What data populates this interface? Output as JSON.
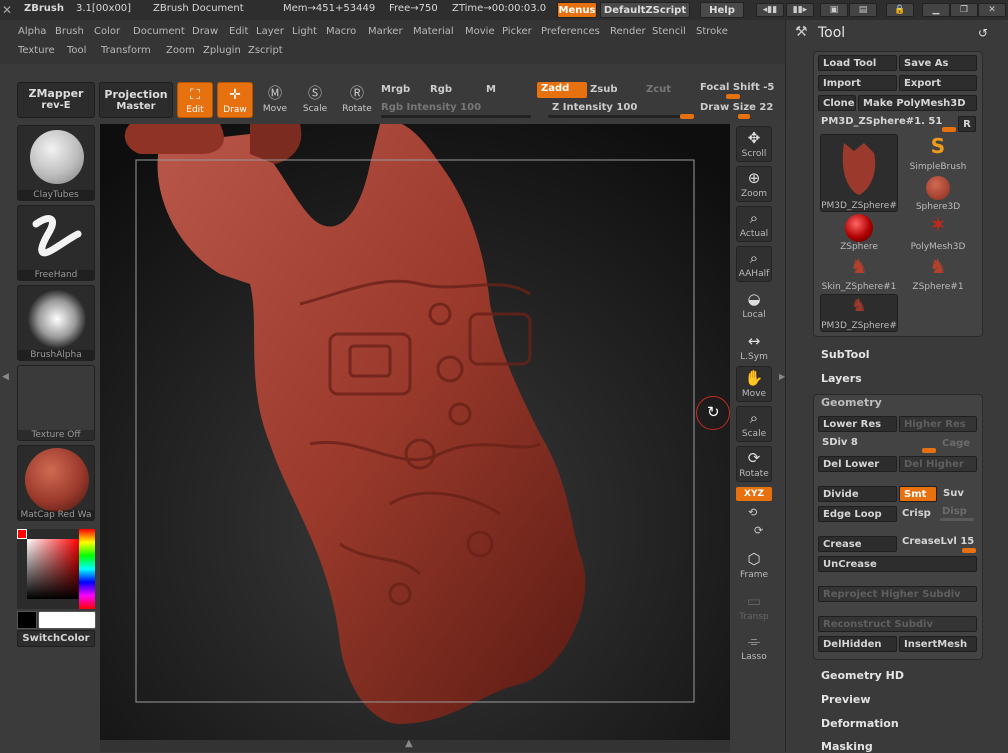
{
  "titlebar": {
    "app": "ZBrush",
    "version": "3.1[00x00]",
    "document": "ZBrush Document",
    "mem": "Mem→451+53449",
    "free": "Free→750",
    "ztime": "ZTime→00:00:03.0",
    "menus_btn": "Menus",
    "zscript_btn": "DefaultZScript",
    "help_btn": "Help"
  },
  "menus_row1": [
    "Alpha",
    "Brush",
    "Color",
    "Document",
    "Draw",
    "Edit",
    "Layer",
    "Light",
    "Macro",
    "Marker",
    "Material",
    "Movie",
    "Picker",
    "Preferences",
    "Render",
    "Stencil",
    "Stroke"
  ],
  "menus_row2": [
    "Texture",
    "Tool",
    "Transform",
    "Zoom",
    "Zplugin",
    "Zscript"
  ],
  "shelf": {
    "zmapper": "ZMapper",
    "zmapper_sub": "rev-E",
    "projection": "Projection",
    "projection_sub": "Master",
    "edit": "Edit",
    "draw": "Draw",
    "move": "Move",
    "scale": "Scale",
    "rotate": "Rotate",
    "mrgb": "Mrgb",
    "rgb": "Rgb",
    "m": "M",
    "zadd": "Zadd",
    "zsub": "Zsub",
    "zcut": "Zcut",
    "focal": "Focal Shift -5",
    "rgb_intensity": "Rgb Intensity 100",
    "z_intensity": "Z Intensity 100",
    "draw_size": "Draw Size 22"
  },
  "lefttray": {
    "brush": "ClayTubes",
    "stroke": "FreeHand",
    "alpha": "BrushAlpha",
    "texture": "Texture Off",
    "material": "MatCap Red Wa",
    "switchcolor": "SwitchColor"
  },
  "righttools": {
    "scroll": "Scroll",
    "zoom": "Zoom",
    "actual": "Actual",
    "aahalf": "AAHalf",
    "local": "Local",
    "lsym": "L.Sym",
    "move": "Move",
    "scale": "Scale",
    "rotate": "Rotate",
    "xyz": "XYZ",
    "frame": "Frame",
    "transp": "Transp",
    "lasso": "Lasso"
  },
  "tool_panel": {
    "title": "Tool",
    "load_tool": "Load Tool",
    "save_as": "Save As",
    "import": "Import",
    "export": "Export",
    "clone": "Clone",
    "make_polymesh": "Make PolyMesh3D",
    "current": "PM3D_ZSphere#1. 51",
    "r_btn": "R",
    "thumbs": [
      "PM3D_ZSphere#",
      "SimpleBrush",
      "Sphere3D",
      "ZSphere",
      "PolyMesh3D",
      "Skin_ZSphere#1",
      "ZSphere#1",
      "PM3D_ZSphere#"
    ]
  },
  "sections": {
    "subtool": "SubTool",
    "layers": "Layers",
    "geometry": "Geometry",
    "geometry_hd": "Geometry HD",
    "preview": "Preview",
    "deformation": "Deformation",
    "masking": "Masking"
  },
  "geometry": {
    "lower_res": "Lower Res",
    "higher_res": "Higher Res",
    "sdiv": "SDiv 8",
    "cage": "Cage",
    "del_lower": "Del Lower",
    "del_higher": "Del Higher",
    "divide": "Divide",
    "smt": "Smt",
    "suv": "Suv",
    "edge_loop": "Edge Loop",
    "crisp": "Crisp",
    "disp": "Disp",
    "crease": "Crease",
    "creaselvl": "CreaseLvl 15",
    "uncrease": "UnCrease",
    "reproject": "Reproject Higher Subdiv",
    "reconstruct": "Reconstruct Subdiv",
    "delhidden": "DelHidden",
    "insertmesh": "InsertMesh"
  },
  "colors": {
    "accent": "#e7700f",
    "mesh": "#9b3a2c"
  }
}
